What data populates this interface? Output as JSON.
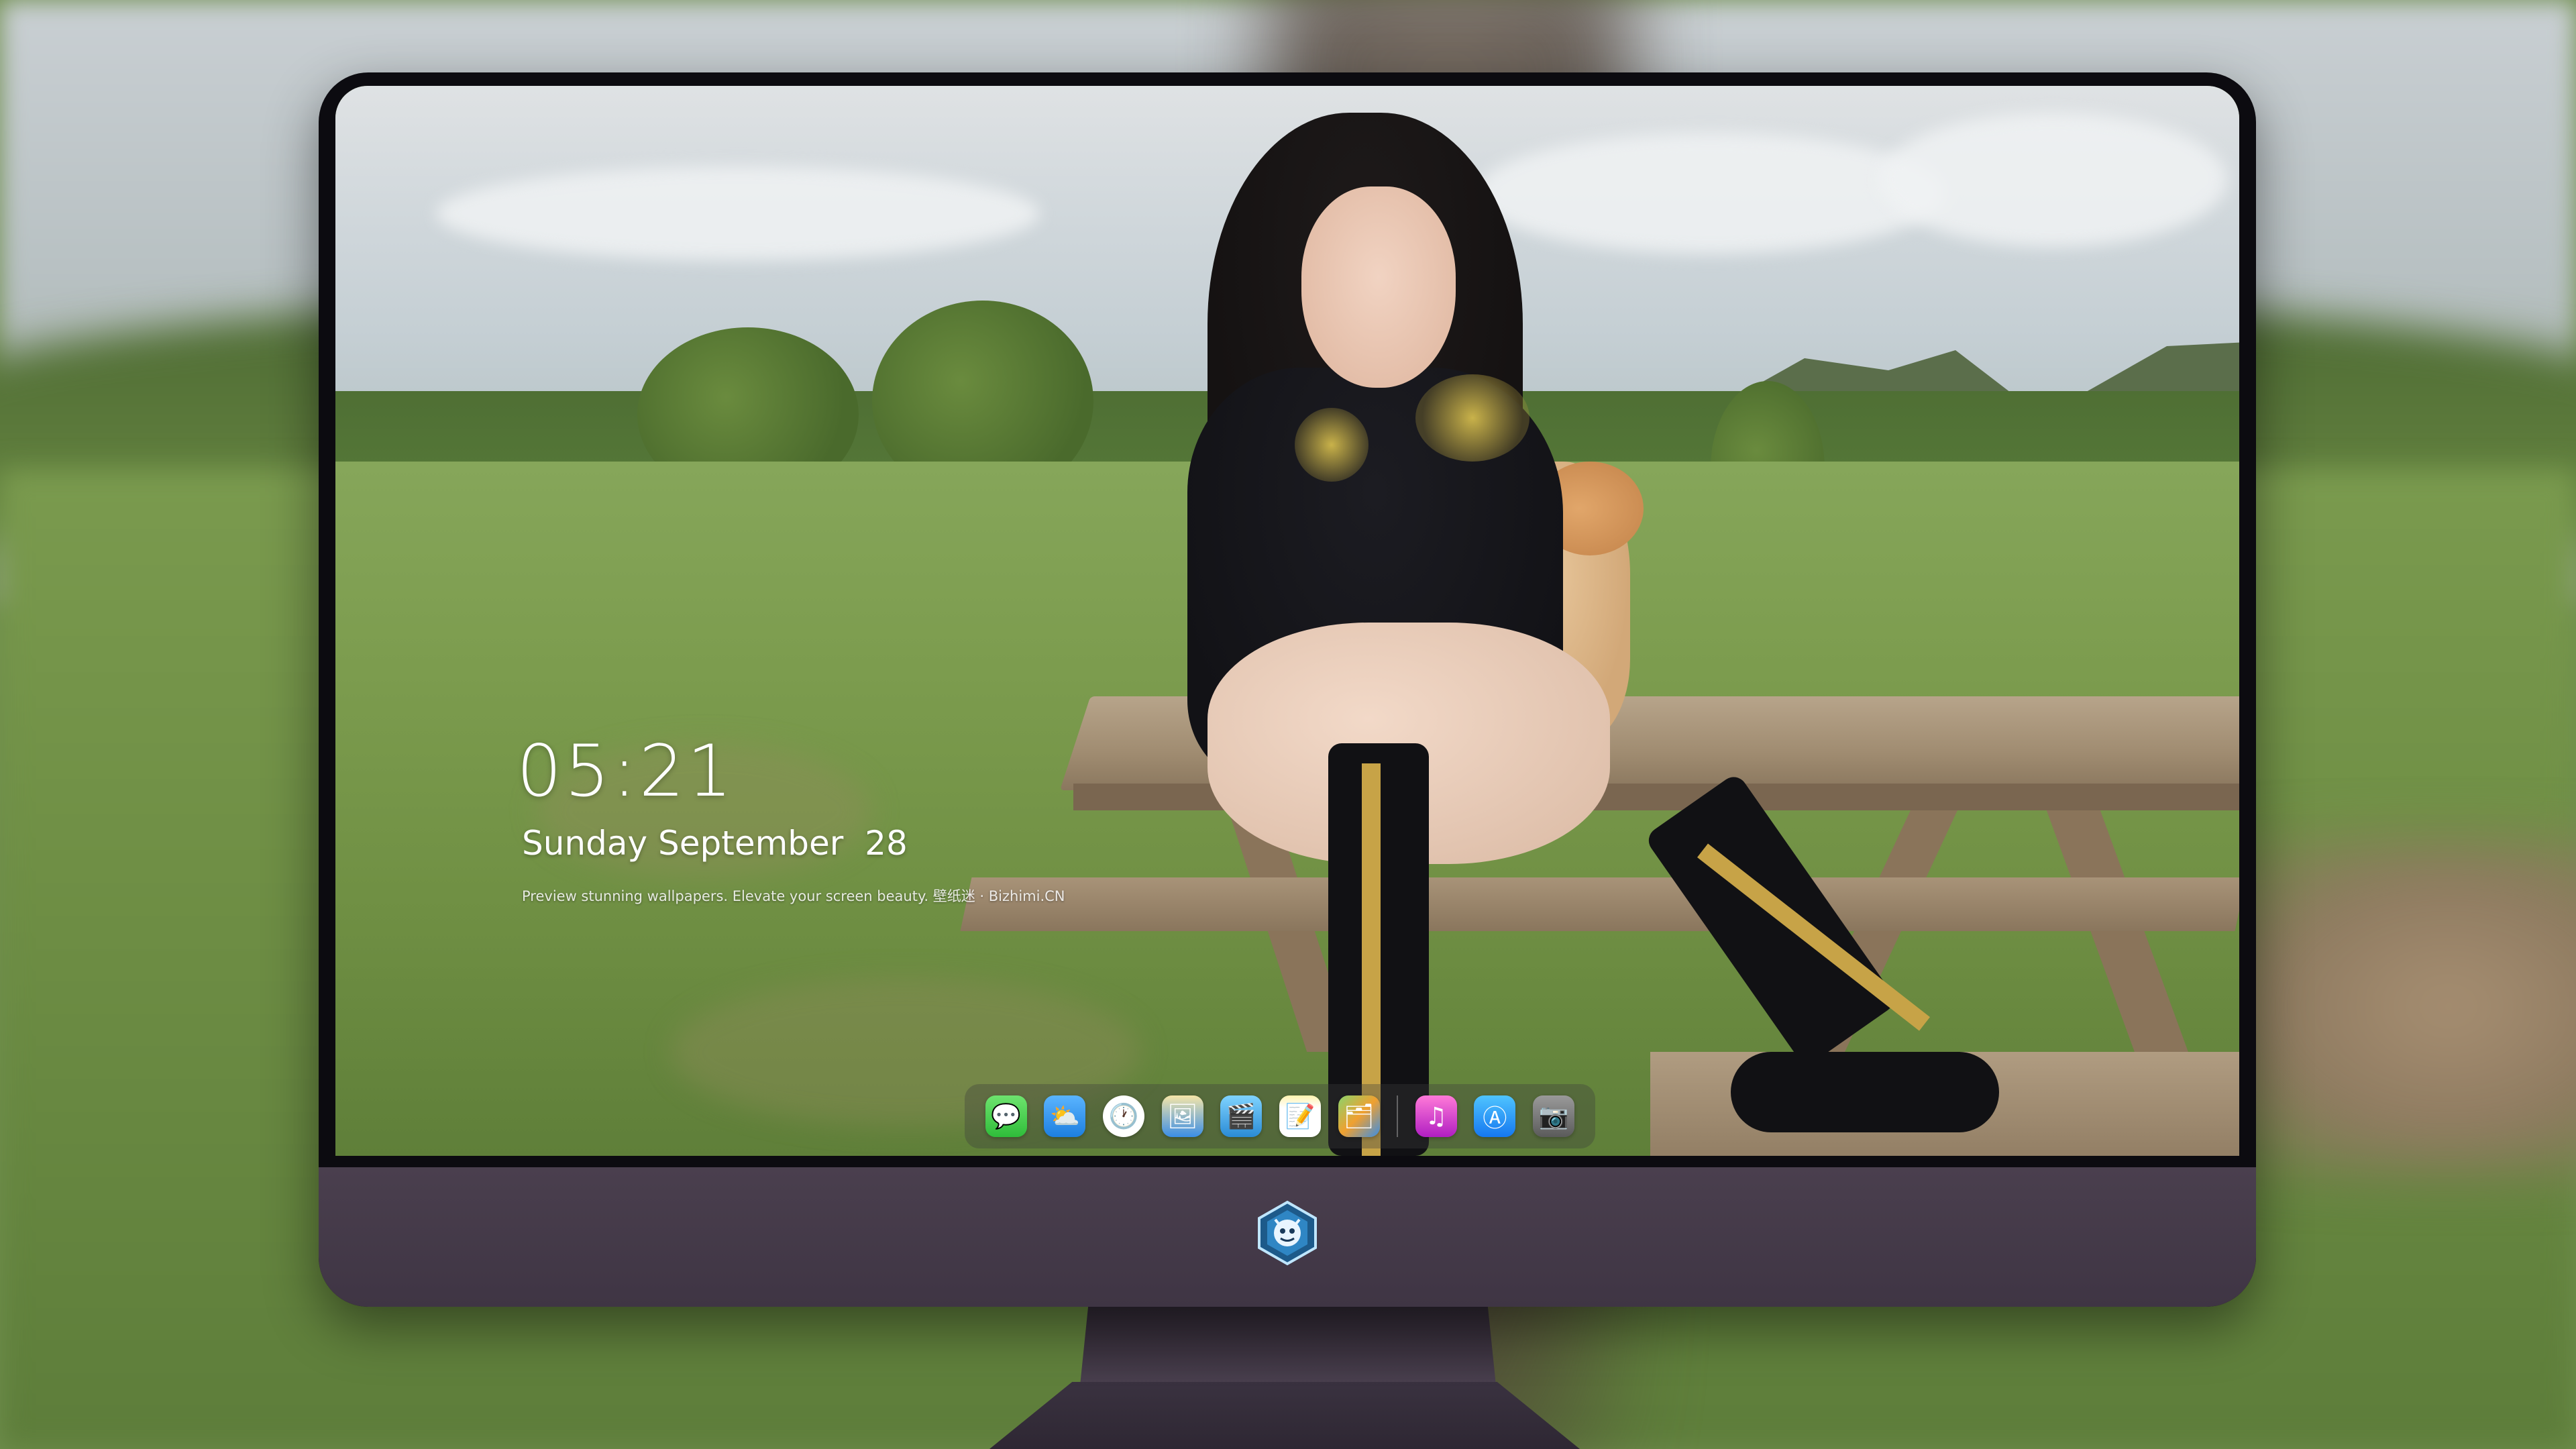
{
  "lockscreen": {
    "time": "05:21",
    "date": "Sunday September  28",
    "caption": "Preview stunning wallpapers. Elevate your screen beauty. 壁纸迷 · Bizhimi.CN"
  },
  "dock": {
    "apps": [
      {
        "name": "Messages",
        "icon": "messages-icon",
        "glyph": "💬"
      },
      {
        "name": "Weather",
        "icon": "weather-icon",
        "glyph": "⛅"
      },
      {
        "name": "Clock",
        "icon": "clock-icon",
        "glyph": "🕐"
      },
      {
        "name": "Preview",
        "icon": "preview-icon",
        "glyph": "🖼"
      },
      {
        "name": "Clips",
        "icon": "clapper-icon",
        "glyph": "🎬"
      },
      {
        "name": "Notes",
        "icon": "notes-icon",
        "glyph": "📝"
      },
      {
        "name": "Photos",
        "icon": "photos-icon",
        "glyph": "🗂"
      },
      {
        "name": "Music",
        "icon": "music-icon",
        "glyph": "♫"
      },
      {
        "name": "App Store",
        "icon": "app-store-icon",
        "glyph": "Ⓐ"
      },
      {
        "name": "Camera",
        "icon": "camera-icon",
        "glyph": "📷"
      }
    ]
  },
  "monitor": {
    "logo": "dragon-emblem-logo",
    "chin_color": "#443a48",
    "bezel_color": "#0c0b10"
  }
}
